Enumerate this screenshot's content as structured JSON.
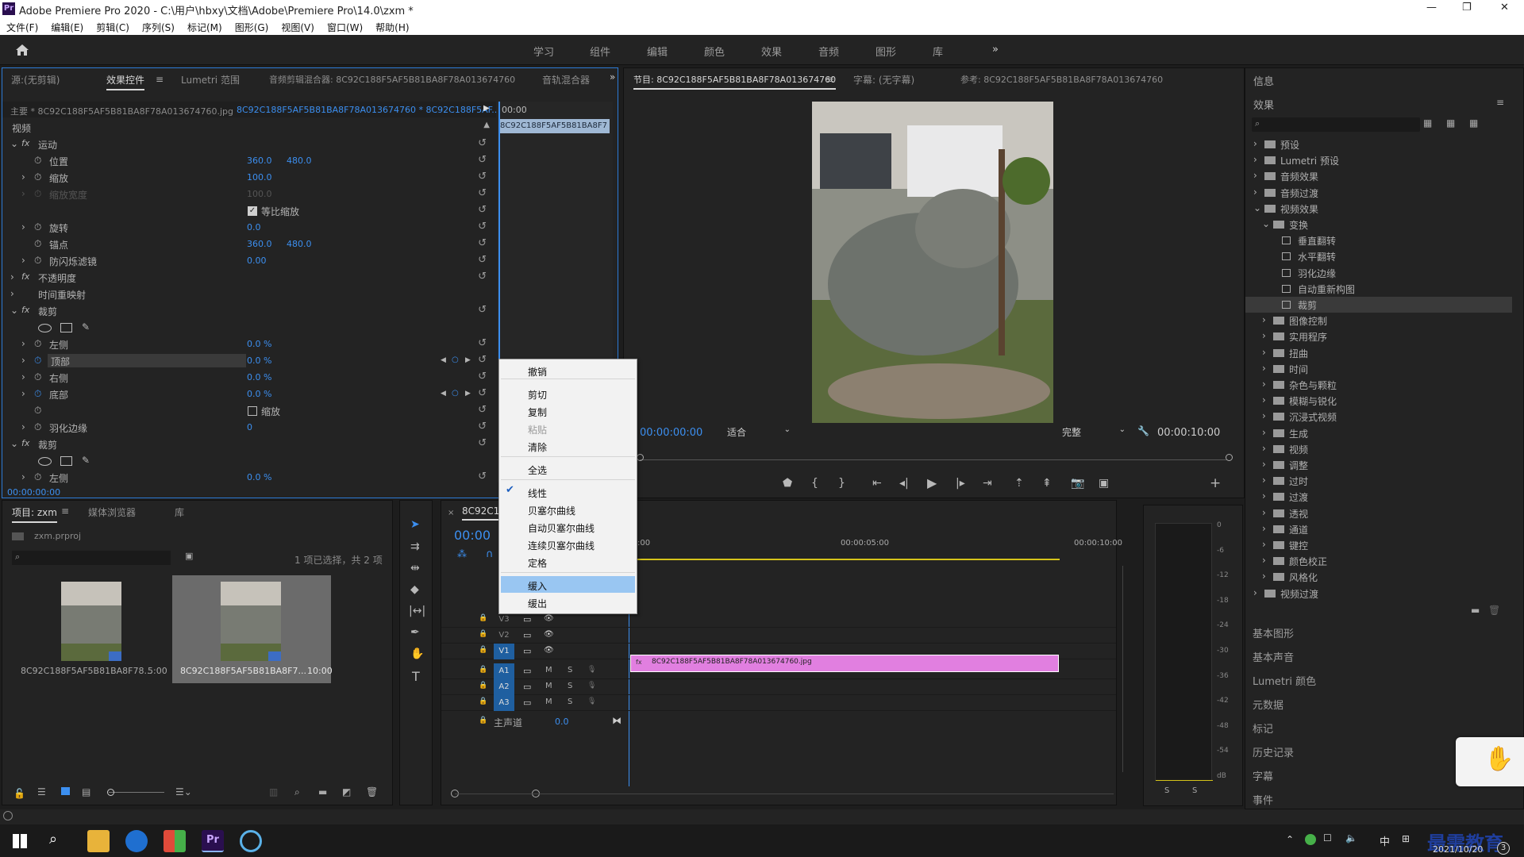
{
  "title": "Adobe Premiere Pro 2020 - C:\\用户\\hbxy\\文档\\Adobe\\Premiere Pro\\14.0\\zxm *",
  "app_badge": "Pr",
  "window_controls": [
    "—",
    "❐",
    "✕"
  ],
  "menu": [
    "文件(F)",
    "编辑(E)",
    "剪辑(C)",
    "序列(S)",
    "标记(M)",
    "图形(G)",
    "视图(V)",
    "窗口(W)",
    "帮助(H)"
  ],
  "workspaces": [
    "学习",
    "组件",
    "编辑",
    "颜色",
    "效果",
    "音频",
    "图形",
    "库"
  ],
  "workspace_more": "»",
  "source_tabs": [
    "源:(无剪辑)",
    "效果控件",
    "Lumetri 范围",
    "音频剪辑混合器: 8C92C188F5AF5B81BA8F78A013674760",
    "音轨混合器"
  ],
  "ec": {
    "master": "主要 * 8C92C188F5AF5B81BA8F78A013674760.jpg",
    "clip": "8C92C188F5AF5B81BA8F78A013674760 * 8C92C188F5AF...",
    "timecode": "00:00",
    "clip_bar": "8C92C188F5AF5B81BA8F7",
    "section": "视频",
    "motion": "运动",
    "position": "位置",
    "pos_x": "360.0",
    "pos_y": "480.0",
    "scale": "缩放",
    "scale_v": "100.0",
    "scale_w": "缩放宽度",
    "scale_w_v": "100.0",
    "uniform": "等比缩放",
    "rotation": "旋转",
    "rotation_v": "0.0",
    "anchor": "锚点",
    "anchor_x": "360.0",
    "anchor_y": "480.0",
    "flicker": "防闪烁滤镜",
    "flicker_v": "0.00",
    "opacity": "不透明度",
    "remap": "时间重映射",
    "crop": "裁剪",
    "left": "左侧",
    "left_v": "0.0 %",
    "top": "顶部",
    "top_v": "0.0 %",
    "right": "右侧",
    "right_v": "0.0 %",
    "bottom": "底部",
    "bottom_v": "0.0 %",
    "zoom": "缩放",
    "feather": "羽化边缘",
    "feather_v": "0",
    "crop2": "裁剪",
    "left2": "左侧",
    "left2_v": "0.0 %",
    "footer_tc": "00:00:00:00",
    "fx": "fx"
  },
  "context_menu": [
    "撤销",
    "剪切",
    "复制",
    "粘贴",
    "清除",
    "全选",
    "线性",
    "贝塞尔曲线",
    "自动贝塞尔曲线",
    "连续贝塞尔曲线",
    "定格",
    "缓入",
    "缓出"
  ],
  "program": {
    "tabs": [
      "节目: 8C92C188F5AF5B81BA8F78A013674760",
      "字幕: (无字幕)",
      "参考: 8C92C188F5AF5B81BA8F78A013674760"
    ],
    "timecode": "00:00:00:00",
    "fit": "适合",
    "quality": "完整",
    "duration": "00:00:10:00"
  },
  "project": {
    "tabs": [
      "项目: zxm",
      "媒体浏览器",
      "库"
    ],
    "file": "zxm.prproj",
    "selection": "1 项已选择，共 2 项",
    "items": [
      {
        "name": "8C92C188F5AF5B81BA8F78...",
        "dur": "5:00"
      },
      {
        "name": "8C92C188F5AF5B81BA8F7...",
        "dur": "10:00"
      }
    ]
  },
  "timeline": {
    "tab": "8C92C18",
    "timecode": "00:00",
    "ruler": [
      ":00",
      "00:00:05:00",
      "00:00:10:00"
    ],
    "clip": "8C92C188F5AF5B81BA8F78A013674760.jpg",
    "video_tracks": [
      "V3",
      "V2",
      "V1"
    ],
    "audio_tracks": [
      "A1",
      "A2",
      "A3"
    ],
    "master": "主声道",
    "master_v": "0.0",
    "ms": [
      "M",
      "S"
    ]
  },
  "meter": {
    "scale": [
      "0",
      "-6",
      "-12",
      "-18",
      "-24",
      "-30",
      "-36",
      "-42",
      "-48",
      "-54",
      "dB"
    ],
    "solo": [
      "S",
      "S"
    ]
  },
  "right": {
    "info": "信息",
    "effects": "效果",
    "tree": [
      "预设",
      "Lumetri 预设",
      "音频效果",
      "音频过渡",
      "视频效果",
      "变换",
      "垂直翻转",
      "水平翻转",
      "羽化边缘",
      "自动重新构图",
      "裁剪",
      "图像控制",
      "实用程序",
      "扭曲",
      "时间",
      "杂色与颗粒",
      "模糊与锐化",
      "沉浸式视频",
      "生成",
      "视频",
      "调整",
      "过时",
      "过渡",
      "透视",
      "通道",
      "键控",
      "颜色校正",
      "风格化",
      "视频过渡"
    ],
    "panels": [
      "基本图形",
      "基本声音",
      "Lumetri 颜色",
      "元数据",
      "标记",
      "历史记录",
      "字幕",
      "事件"
    ]
  },
  "taskbar": {
    "date": "2021/10/20",
    "ime": "中",
    "watermark": "最需教育",
    "badge": "3"
  },
  "colors": {
    "accent": "#3c8ff0",
    "clip": "#e17fe0",
    "panel": "#232323",
    "bg": "#1d1d1d",
    "highlight": "#99c6f2"
  }
}
